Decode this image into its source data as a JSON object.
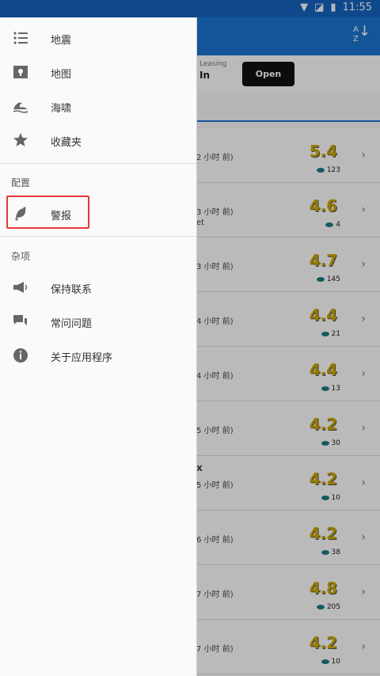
{
  "status_bar": {
    "time": "11:55",
    "icons": [
      "wifi-icon",
      "no-sim-icon",
      "battery-icon"
    ]
  },
  "ad": {
    "line1": "Leasing",
    "line2": "In",
    "open_label": "Open"
  },
  "list_rows": [
    {
      "time": "2 小时 前)",
      "magnitude": "5.4",
      "views": "123",
      "extra": ""
    },
    {
      "time": "3 小时 前)",
      "magnitude": "4.6",
      "views": "4",
      "extra": "et"
    },
    {
      "time": "3 小时 前)",
      "magnitude": "4.7",
      "views": "145",
      "extra": ""
    },
    {
      "time": "4 小时 前)",
      "magnitude": "4.4",
      "views": "21",
      "extra": ""
    },
    {
      "time": "4 小时 前)",
      "magnitude": "4.4",
      "views": "13",
      "extra": ""
    },
    {
      "time": "5 小时 前)",
      "magnitude": "4.2",
      "views": "30",
      "extra": ""
    },
    {
      "time": "5 小时 前)",
      "magnitude": "4.2",
      "views": "10",
      "extra": "x"
    },
    {
      "time": "6 小时 前)",
      "magnitude": "4.2",
      "views": "38",
      "extra": ""
    },
    {
      "time": "7 小时 前)",
      "magnitude": "4.8",
      "views": "205",
      "extra": ""
    },
    {
      "time": "7 小时 前)",
      "magnitude": "4.2",
      "views": "10",
      "extra": ""
    }
  ],
  "drawer": {
    "items_top": [
      {
        "label": "地震",
        "icon": "list-icon"
      },
      {
        "label": "地图",
        "icon": "map-pin-icon"
      },
      {
        "label": "海啸",
        "icon": "wave-icon"
      },
      {
        "label": "收藏夹",
        "icon": "star-icon"
      }
    ],
    "section_config": "配置",
    "alert": {
      "label": "警报",
      "icon": "bell-icon"
    },
    "section_misc": "杂项",
    "items_misc": [
      {
        "label": "保持联系",
        "icon": "megaphone-icon"
      },
      {
        "label": "常问问题",
        "icon": "chat-icon"
      },
      {
        "label": "关于应用程序",
        "icon": "info-icon"
      }
    ]
  },
  "colors": {
    "primary": "#1976d2",
    "highlight": "#e53935",
    "magnitude": "#d0aa00"
  }
}
